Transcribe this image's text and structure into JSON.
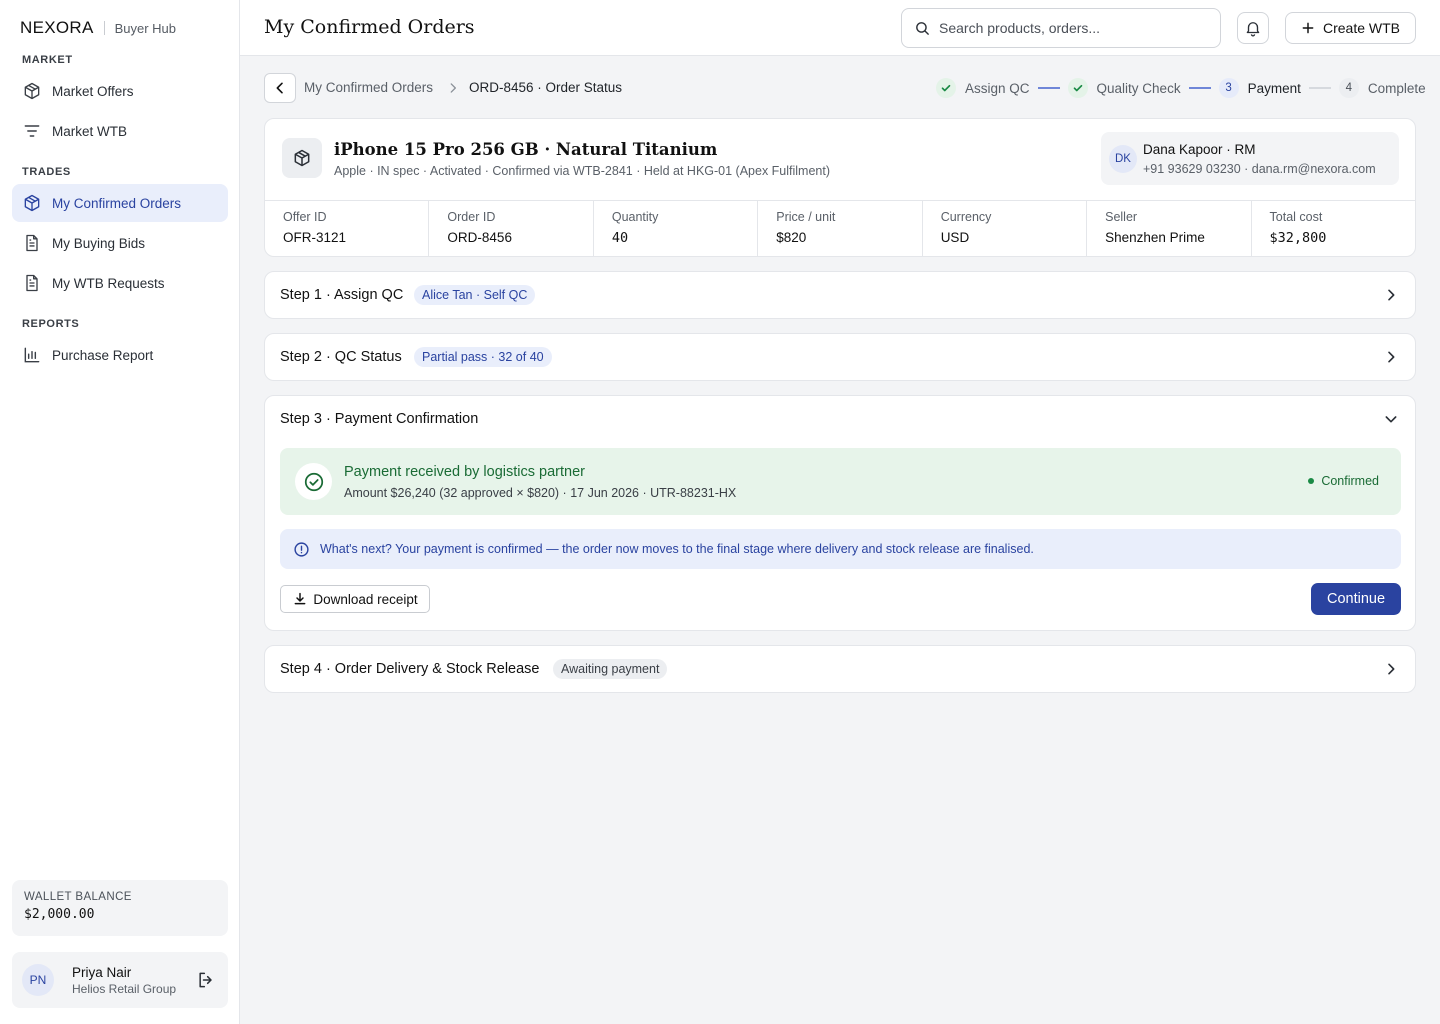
{
  "brand": {
    "name": "NEXORA",
    "sub": "Buyer Hub"
  },
  "sidebar": {
    "sections": [
      {
        "label": "MARKET"
      },
      {
        "label": "TRADES"
      },
      {
        "label": "REPORTS"
      }
    ],
    "items": [
      {
        "label": "Market Offers",
        "icon": "box-icon"
      },
      {
        "label": "Market WTB",
        "icon": "filter-icon"
      },
      {
        "label": "My Confirmed Orders",
        "icon": "box-icon",
        "active": true
      },
      {
        "label": "My Buying Bids",
        "icon": "document-icon"
      },
      {
        "label": "My WTB Requests",
        "icon": "document-icon"
      },
      {
        "label": "Purchase Report",
        "icon": "bar-chart-icon"
      }
    ],
    "wallet": {
      "label": "WALLET BALANCE",
      "value": "$2,000.00"
    },
    "user": {
      "initials": "PN",
      "name": "Priya Nair",
      "org": "Helios Retail Group"
    }
  },
  "header": {
    "title": "My Confirmed Orders",
    "search_placeholder": "Search products, orders...",
    "create_label": "Create WTB"
  },
  "breadcrumb": {
    "parent": "My Confirmed Orders",
    "current": "ORD-8456 · Order Status"
  },
  "stepper": [
    {
      "num": "",
      "label": "Assign QC",
      "state": "done"
    },
    {
      "num": "",
      "label": "Quality Check",
      "state": "done"
    },
    {
      "num": "3",
      "label": "Payment",
      "state": "current"
    },
    {
      "num": "4",
      "label": "Complete",
      "state": "todo"
    }
  ],
  "order": {
    "title": "iPhone 15 Pro 256 GB · Natural Titanium",
    "meta": "Apple · IN spec · Activated · Confirmed via WTB-2841 · Held at HKG-01 (Apex Fulfilment)",
    "rm": {
      "initials": "DK",
      "name": "Dana Kapoor · RM",
      "contact": "+91 93629 03230 · dana.rm@nexora.com"
    },
    "fields": [
      {
        "label": "Offer ID",
        "value": "OFR-3121"
      },
      {
        "label": "Order ID",
        "value": "ORD-8456"
      },
      {
        "label": "Quantity",
        "value": "40"
      },
      {
        "label": "Price / unit",
        "value": "$820"
      },
      {
        "label": "Currency",
        "value": "USD"
      },
      {
        "label": "Seller",
        "value": "Shenzhen Prime"
      },
      {
        "label": "Total cost",
        "value": "$32,800"
      }
    ]
  },
  "steps": {
    "s1": {
      "title": "Step 1 · Assign QC",
      "badge": "Alice Tan · Self QC"
    },
    "s2": {
      "title": "Step 2 · QC Status",
      "badge": "Partial pass · 32 of 40"
    },
    "s3": {
      "title": "Step 3 · Payment Confirmation",
      "pay_title": "Payment received by logistics partner",
      "pay_detail": "Amount $26,240 (32 approved × $820) · 17 Jun 2026 · UTR-88231-HX",
      "pay_status": "Confirmed",
      "info": "What's next? Your payment is confirmed — the order now moves to the final stage where delivery and stock release are finalised.",
      "download_label": "Download receipt",
      "continue_label": "Continue"
    },
    "s4": {
      "title": "Step 4 · Order Delivery & Stock Release",
      "badge": "Awaiting payment"
    }
  },
  "colors": {
    "accent": "#2a43a0",
    "success": "#1a6b35",
    "success_bg": "#e7f4ea",
    "info_bg": "#e9eefb"
  }
}
